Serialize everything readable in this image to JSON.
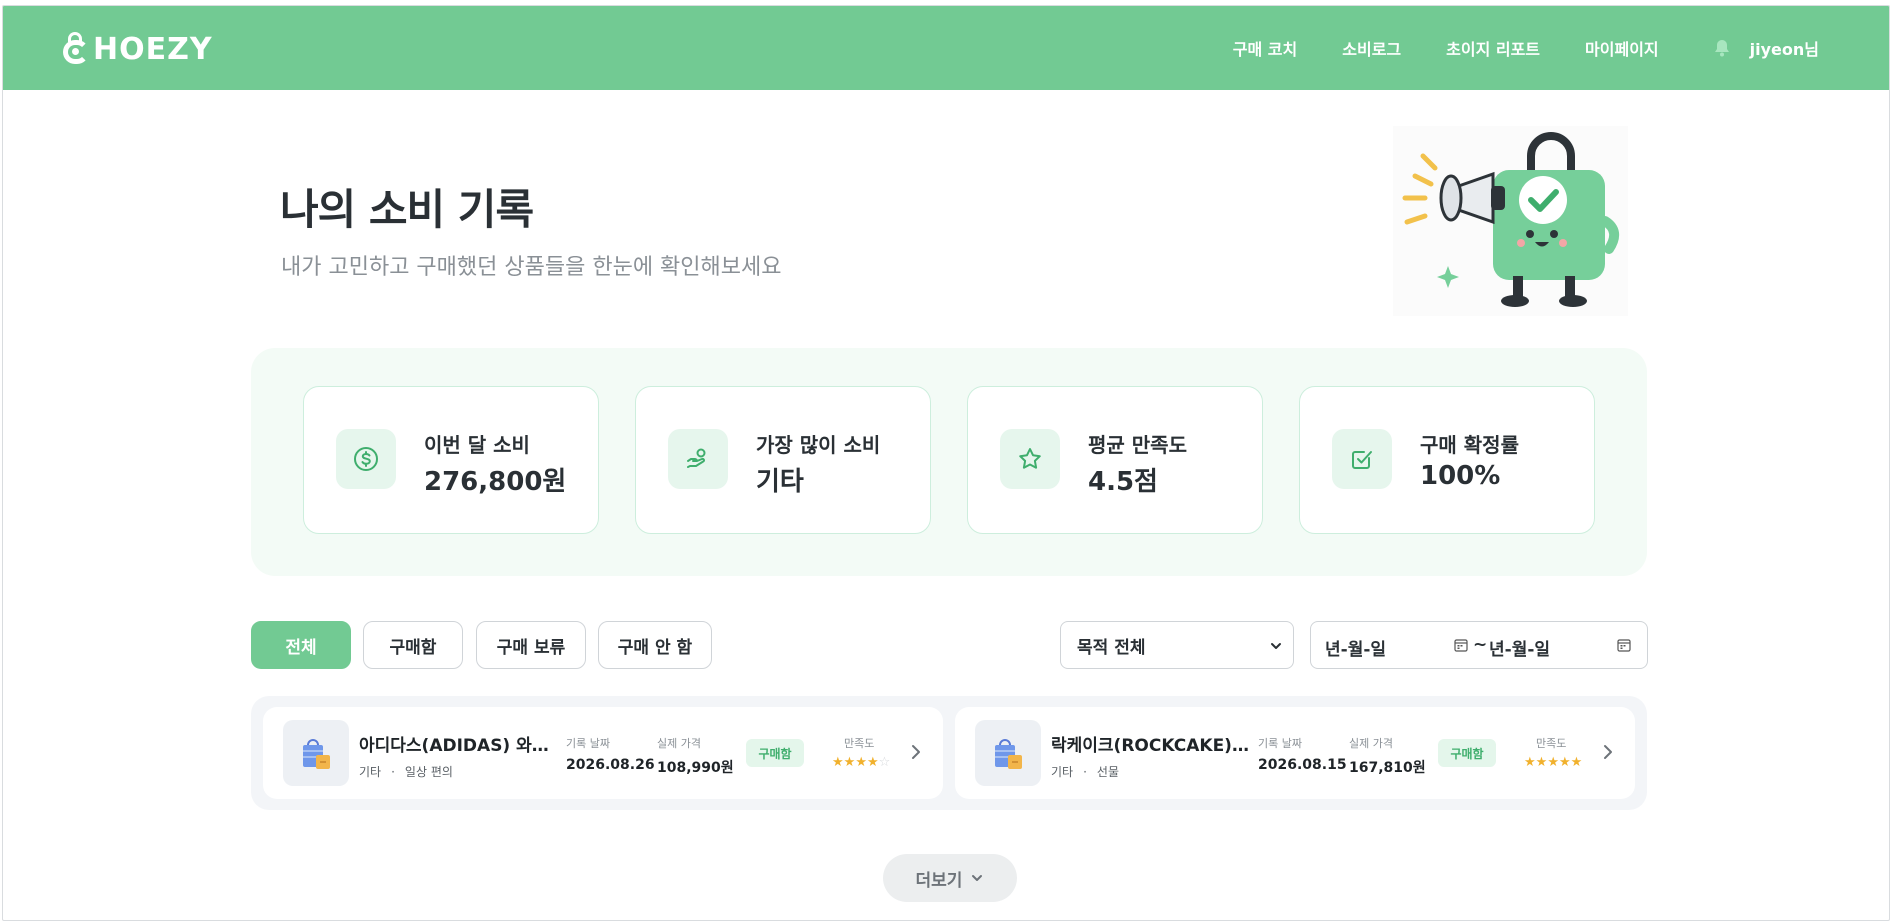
{
  "header": {
    "logo": "CHOEZY",
    "logo_rest": "HOEZY",
    "nav": [
      "구매 코치",
      "소비로그",
      "초이지 리포트",
      "마이페이지"
    ],
    "user": "jiyeon님",
    "accent": "#72ca93"
  },
  "hero": {
    "title": "나의 소비 기록",
    "subtitle": "내가 고민하고 구매했던 상품들을 한눈에 확인해보세요"
  },
  "stats": [
    {
      "icon": "dollar-icon",
      "label": "이번 달 소비",
      "value": "276,800원"
    },
    {
      "icon": "hand-coins-icon",
      "label": "가장 많이 소비",
      "value": "기타"
    },
    {
      "icon": "star-icon",
      "label": "평균 만족도",
      "value": "4.5점"
    },
    {
      "icon": "check-square-icon",
      "label": "구매 확정률",
      "value": "100%"
    }
  ],
  "filters": {
    "tabs": [
      "전체",
      "구매함",
      "구매 보류",
      "구매 안 함"
    ],
    "active_tab": "전체",
    "purpose_select": "목적 전체",
    "date_from_placeholder": "년-월-일",
    "date_sep": "~",
    "date_to_placeholder": "년-월-일"
  },
  "records": [
    {
      "name": "아디다스(ADIDAS) 와플 트레이너",
      "category": "기타",
      "purpose": "일상 편의",
      "date_label": "기록 날짜",
      "date": "2026.08.26",
      "price_label": "실제 가격",
      "price": "108,990원",
      "status": "구매함",
      "satisfaction_label": "만족도",
      "rating": 4
    },
    {
      "name": "락케이크(ROCKCAKE) 케이크",
      "category": "기타",
      "purpose": "선물",
      "date_label": "기록 날짜",
      "date": "2026.08.15",
      "price_label": "실제 가격",
      "price": "167,810원",
      "status": "구매함",
      "satisfaction_label": "만족도",
      "rating": 5
    }
  ],
  "more_label": "더보기"
}
